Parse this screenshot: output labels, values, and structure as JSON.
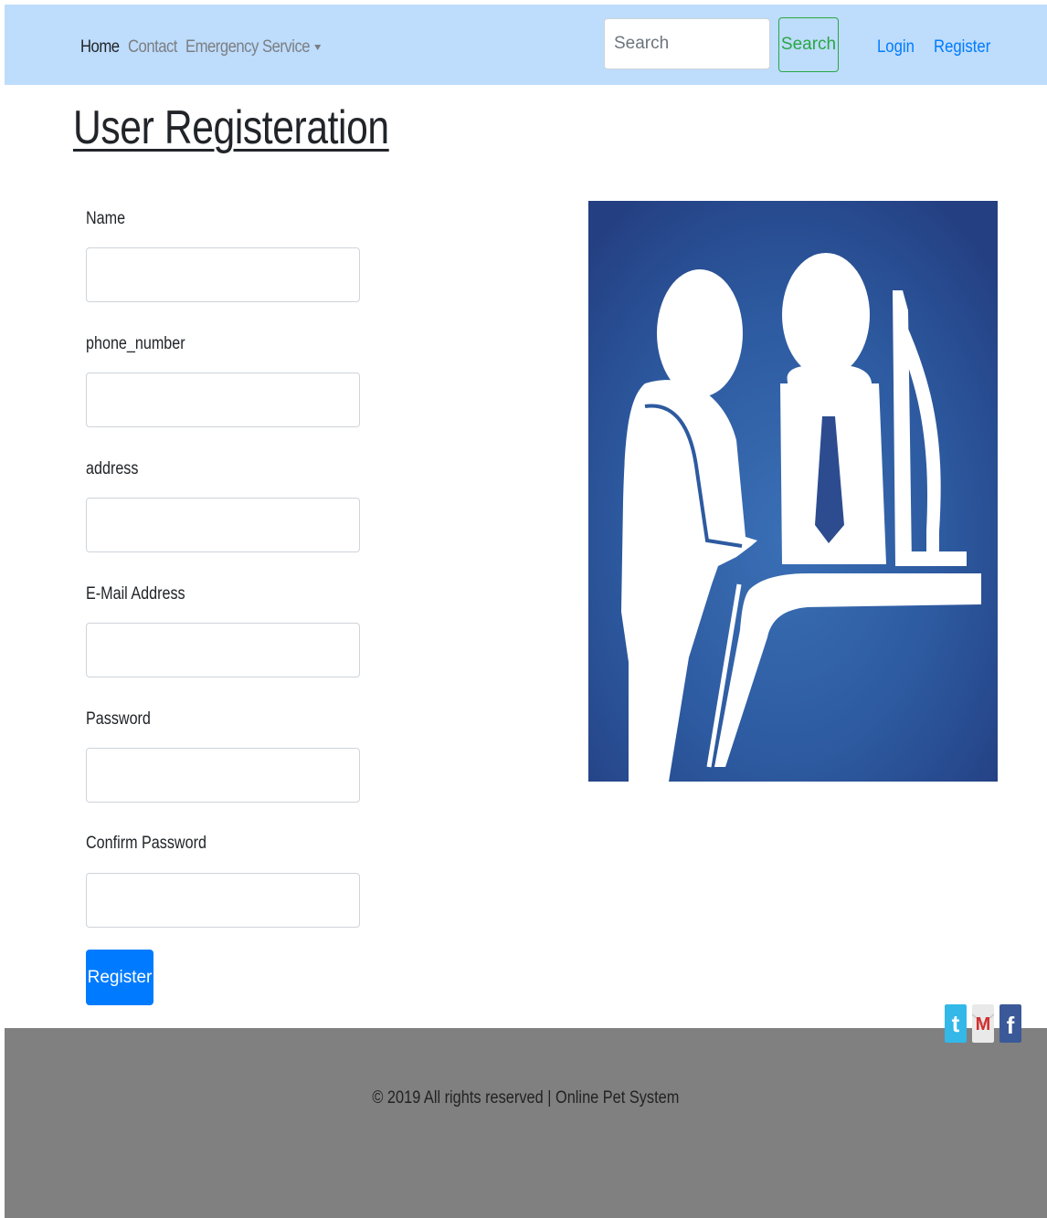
{
  "navbar": {
    "links": [
      "Home",
      "Contact",
      "Emergency",
      "Service"
    ],
    "search": {
      "placeholder": "Search",
      "button_label": "Search"
    },
    "login_label": "Login",
    "register_label": "Register"
  },
  "page": {
    "title": "User Registeration"
  },
  "form": {
    "fields": [
      {
        "label": "Name",
        "value": ""
      },
      {
        "label": "phone_number",
        "value": ""
      },
      {
        "label": "address",
        "value": ""
      },
      {
        "label": "E-Mail Address",
        "value": ""
      },
      {
        "label": "Password",
        "value": ""
      },
      {
        "label": "Confirm Password",
        "value": ""
      }
    ],
    "submit_label": "Register"
  },
  "illustration": {
    "icon": "reception-desk-icon",
    "background": "#2d4c8f"
  },
  "footer": {
    "copyright": "© 2019 All rights reserved | Online Pet System",
    "social_icons": [
      "twitter-icon",
      "gmail-icon",
      "facebook-icon"
    ]
  },
  "colors": {
    "navbar_bg": "#bedcfb",
    "primary": "#007bff",
    "success": "#28a745",
    "footer_bg": "#808080"
  }
}
